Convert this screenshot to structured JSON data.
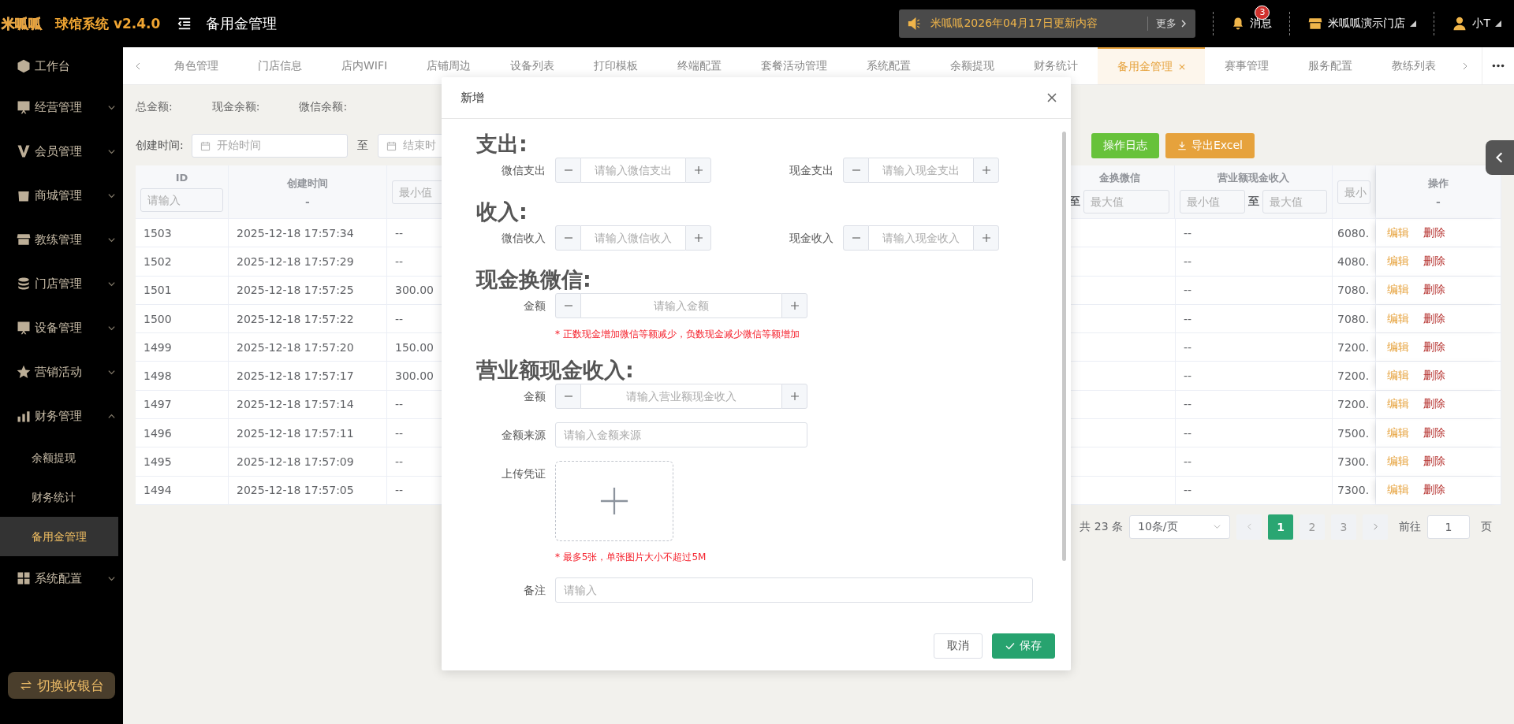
{
  "header": {
    "logo": "米呱呱",
    "app_name": "球馆系统 v2.4.0",
    "page_title": "备用金管理",
    "notice": {
      "text": "米呱呱2026年04月17日更新内容",
      "more": "更多"
    },
    "messages": {
      "label": "消息",
      "badge": "3"
    },
    "store": "米呱呱演示门店",
    "user": "小T"
  },
  "sidebar": {
    "items": [
      {
        "label": "工作台"
      },
      {
        "label": "经营管理",
        "expanded": false
      },
      {
        "label": "会员管理",
        "expanded": false
      },
      {
        "label": "商城管理",
        "expanded": false
      },
      {
        "label": "教练管理",
        "expanded": false
      },
      {
        "label": "门店管理",
        "expanded": false
      },
      {
        "label": "设备管理",
        "expanded": false
      },
      {
        "label": "营销活动",
        "expanded": false
      },
      {
        "label": "财务管理",
        "expanded": true,
        "children": [
          {
            "label": "余额提现",
            "selected": false
          },
          {
            "label": "财务统计",
            "selected": false
          },
          {
            "label": "备用金管理",
            "selected": true
          }
        ]
      },
      {
        "label": "系统配置",
        "expanded": false
      }
    ],
    "switch_button": "切换收银台"
  },
  "tabs": [
    {
      "label": "角色管理",
      "selected": false
    },
    {
      "label": "门店信息",
      "selected": false
    },
    {
      "label": "店内WIFI",
      "selected": false
    },
    {
      "label": "店铺周边",
      "selected": false
    },
    {
      "label": "设备列表",
      "selected": false
    },
    {
      "label": "打印模板",
      "selected": false
    },
    {
      "label": "终端配置",
      "selected": false
    },
    {
      "label": "套餐活动管理",
      "selected": false
    },
    {
      "label": "系统配置",
      "selected": false
    },
    {
      "label": "余额提现",
      "selected": false
    },
    {
      "label": "财务统计",
      "selected": false
    },
    {
      "label": "备用金管理",
      "selected": true
    },
    {
      "label": "赛事管理",
      "selected": false
    },
    {
      "label": "服务配置",
      "selected": false
    },
    {
      "label": "教练列表",
      "selected": false
    }
  ],
  "summary": [
    "总金额:",
    "现金余额:",
    "微信余额:"
  ],
  "filter": {
    "label": "创建时间:",
    "start_placeholder": "开始时间",
    "separator": "至",
    "end_placeholder": "结束时"
  },
  "actions": [
    {
      "label": "操作日志",
      "kind": "log"
    },
    {
      "label": "导出Excel",
      "kind": "export"
    }
  ],
  "table": {
    "columns": [
      {
        "title": "ID",
        "filter": {
          "kind": "text",
          "placeholder": "请输入"
        }
      },
      {
        "title": "创建时间",
        "sub": "-"
      },
      {
        "filter": {
          "kind": "min",
          "placeholder": "最小值"
        }
      },
      {
        "title": "金换微信",
        "filter": {
          "kind": "max",
          "separator": "至",
          "placeholder": "最大值"
        }
      },
      {
        "title": "营业额现金收入",
        "filter": {
          "kind": "range",
          "min_placeholder": "最小值",
          "separator": "至",
          "max_placeholder": "最大值"
        }
      },
      {
        "filter": {
          "kind": "min",
          "placeholder": "最小"
        }
      },
      {
        "title": "操作",
        "sub": "-"
      }
    ],
    "rows": [
      {
        "id": "1503",
        "created": "2025-12-18 17:57:34",
        "column_3": "--",
        "column_5": "--",
        "column_6": "6080.",
        "edit": "编辑",
        "delete": "删除"
      },
      {
        "id": "1502",
        "created": "2025-12-18 17:57:29",
        "column_3": "--",
        "column_5": "--",
        "column_6": "4080.",
        "edit": "编辑",
        "delete": "删除"
      },
      {
        "id": "1501",
        "created": "2025-12-18 17:57:25",
        "column_3": "300.00",
        "column_5": "--",
        "column_6": "7080.",
        "edit": "编辑",
        "delete": "删除"
      },
      {
        "id": "1500",
        "created": "2025-12-18 17:57:22",
        "column_3": "--",
        "column_5": "--",
        "column_6": "7080.",
        "edit": "编辑",
        "delete": "删除"
      },
      {
        "id": "1499",
        "created": "2025-12-18 17:57:20",
        "column_3": "150.00",
        "column_5": "--",
        "column_6": "7200.",
        "edit": "编辑",
        "delete": "删除"
      },
      {
        "id": "1498",
        "created": "2025-12-18 17:57:17",
        "column_3": "300.00",
        "column_5": "--",
        "column_6": "7200.",
        "edit": "编辑",
        "delete": "删除"
      },
      {
        "id": "1497",
        "created": "2025-12-18 17:57:14",
        "column_3": "--",
        "column_5": "--",
        "column_6": "7200.",
        "edit": "编辑",
        "delete": "删除"
      },
      {
        "id": "1496",
        "created": "2025-12-18 17:57:11",
        "column_3": "--",
        "column_5": "--",
        "column_6": "7500.",
        "edit": "编辑",
        "delete": "删除"
      },
      {
        "id": "1495",
        "created": "2025-12-18 17:57:09",
        "column_3": "--",
        "column_5": "--",
        "column_6": "7300.",
        "edit": "编辑",
        "delete": "删除"
      },
      {
        "id": "1494",
        "created": "2025-12-18 17:57:05",
        "column_3": "--",
        "column_5": "--",
        "column_6": "7300.",
        "edit": "编辑",
        "delete": "删除"
      }
    ]
  },
  "pagination": {
    "total": "共 23 条",
    "page_size": "10条/页",
    "pages": [
      {
        "label": "1",
        "selected": true
      },
      {
        "label": "2",
        "selected": false
      },
      {
        "label": "3",
        "selected": false
      }
    ],
    "goto_label": "前往",
    "goto_value": "1",
    "page_unit": "页"
  },
  "modal": {
    "title": "新增",
    "sections": [
      {
        "heading": "支出:",
        "fields": [
          {
            "kind": "number",
            "label": "微信支出",
            "placeholder": "请输入微信支出"
          },
          {
            "kind": "number",
            "label": "现金支出",
            "placeholder": "请输入现金支出"
          }
        ]
      },
      {
        "heading": "收入:",
        "fields": [
          {
            "kind": "number",
            "label": "微信收入",
            "placeholder": "请输入微信收入"
          },
          {
            "kind": "number",
            "label": "现金收入",
            "placeholder": "请输入现金收入"
          }
        ]
      },
      {
        "heading": "现金换微信:",
        "fields": [
          {
            "kind": "number-wide",
            "label": "金额",
            "placeholder": "请输入金额",
            "note": "* 正数现金增加微信等额减少，负数现金减少微信等额增加"
          }
        ]
      },
      {
        "heading": "营业额现金收入:",
        "fields": [
          {
            "kind": "number-wide",
            "label": "金额",
            "placeholder": "请输入营业额现金收入"
          },
          {
            "kind": "text",
            "label": "金额来源",
            "placeholder": "请输入金额来源"
          },
          {
            "kind": "upload",
            "label": "上传凭证",
            "note": "* 最多5张，单张图片大小不超过5M"
          },
          {
            "kind": "textarea",
            "label": "备注",
            "placeholder": "请输入"
          }
        ]
      }
    ],
    "buttons": [
      {
        "label": "取消",
        "kind": "cancel"
      },
      {
        "label": "保存",
        "kind": "save"
      }
    ]
  }
}
